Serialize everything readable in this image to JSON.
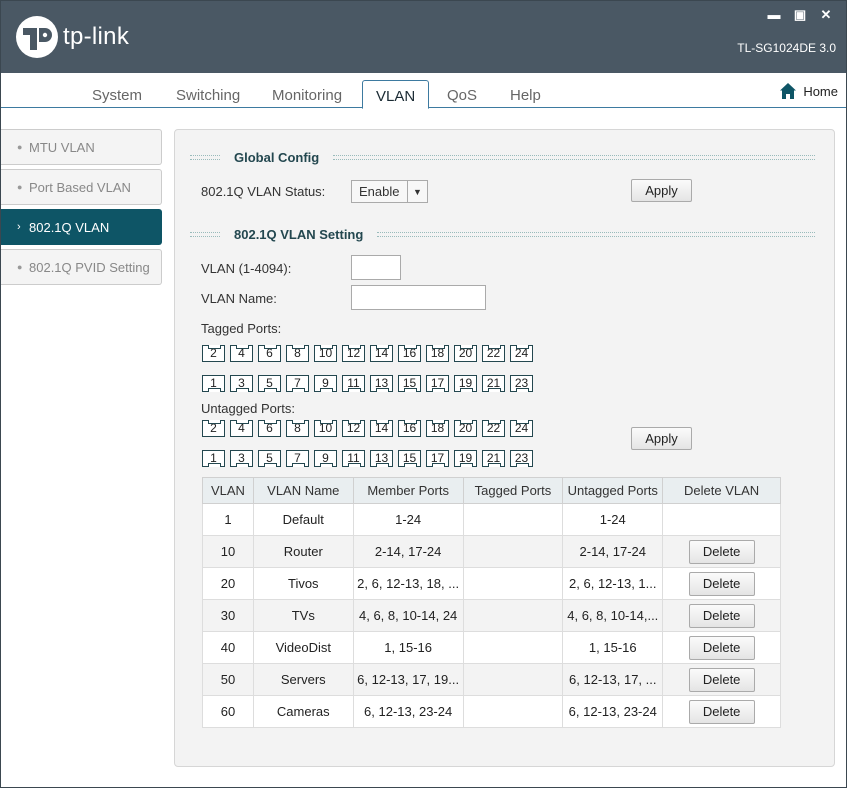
{
  "app": {
    "logo_text": "tp-link",
    "model": "TL-SG1024DE 3.0"
  },
  "window_controls": {
    "minimize": "▬",
    "maximize": "▣",
    "close": "✕"
  },
  "nav": {
    "tabs": [
      "System",
      "Switching",
      "Monitoring",
      "VLAN",
      "QoS",
      "Help"
    ],
    "active": "VLAN",
    "home_label": "Home"
  },
  "sidebar": {
    "items": [
      {
        "label": "MTU VLAN",
        "active": false
      },
      {
        "label": "Port Based VLAN",
        "active": false
      },
      {
        "label": "802.1Q VLAN",
        "active": true
      },
      {
        "label": "802.1Q PVID Setting",
        "active": false
      }
    ]
  },
  "global_config": {
    "title": "Global Config",
    "status_label": "802.1Q VLAN Status:",
    "status_value": "Enable",
    "apply_label": "Apply"
  },
  "vlan_setting": {
    "title": "802.1Q VLAN Setting",
    "vlan_id_label": "VLAN (1-4094):",
    "vlan_id_value": "",
    "vlan_name_label": "VLAN Name:",
    "vlan_name_value": "",
    "tagged_label": "Tagged Ports:",
    "untagged_label": "Untagged Ports:",
    "ports_even": [
      "2",
      "4",
      "6",
      "8",
      "10",
      "12",
      "14",
      "16",
      "18",
      "20",
      "22",
      "24"
    ],
    "ports_odd": [
      "1",
      "3",
      "5",
      "7",
      "9",
      "11",
      "13",
      "15",
      "17",
      "19",
      "21",
      "23"
    ],
    "apply_label": "Apply"
  },
  "table": {
    "headers": [
      "VLAN",
      "VLAN Name",
      "Member Ports",
      "Tagged Ports",
      "Untagged Ports",
      "Delete VLAN"
    ],
    "delete_label": "Delete",
    "rows": [
      {
        "vlan": "1",
        "name": "Default",
        "member": "1-24",
        "tagged": "",
        "untagged": "1-24",
        "deletable": false
      },
      {
        "vlan": "10",
        "name": "Router",
        "member": "2-14, 17-24",
        "tagged": "",
        "untagged": "2-14, 17-24",
        "deletable": true
      },
      {
        "vlan": "20",
        "name": "Tivos",
        "member": "2, 6, 12-13, 18, ...",
        "tagged": "",
        "untagged": "2, 6, 12-13, 1...",
        "deletable": true
      },
      {
        "vlan": "30",
        "name": "TVs",
        "member": "4, 6, 8, 10-14, 24",
        "tagged": "",
        "untagged": "4, 6, 8, 10-14,...",
        "deletable": true
      },
      {
        "vlan": "40",
        "name": "VideoDist",
        "member": "1, 15-16",
        "tagged": "",
        "untagged": "1, 15-16",
        "deletable": true
      },
      {
        "vlan": "50",
        "name": "Servers",
        "member": "6, 12-13, 17, 19...",
        "tagged": "",
        "untagged": "6, 12-13, 17, ...",
        "deletable": true
      },
      {
        "vlan": "60",
        "name": "Cameras",
        "member": "6, 12-13, 23-24",
        "tagged": "",
        "untagged": "6, 12-13, 23-24",
        "deletable": true
      }
    ]
  },
  "colors": {
    "titlebar": "#4a5864",
    "accent": "#0e5566",
    "section_title": "#23474f"
  }
}
